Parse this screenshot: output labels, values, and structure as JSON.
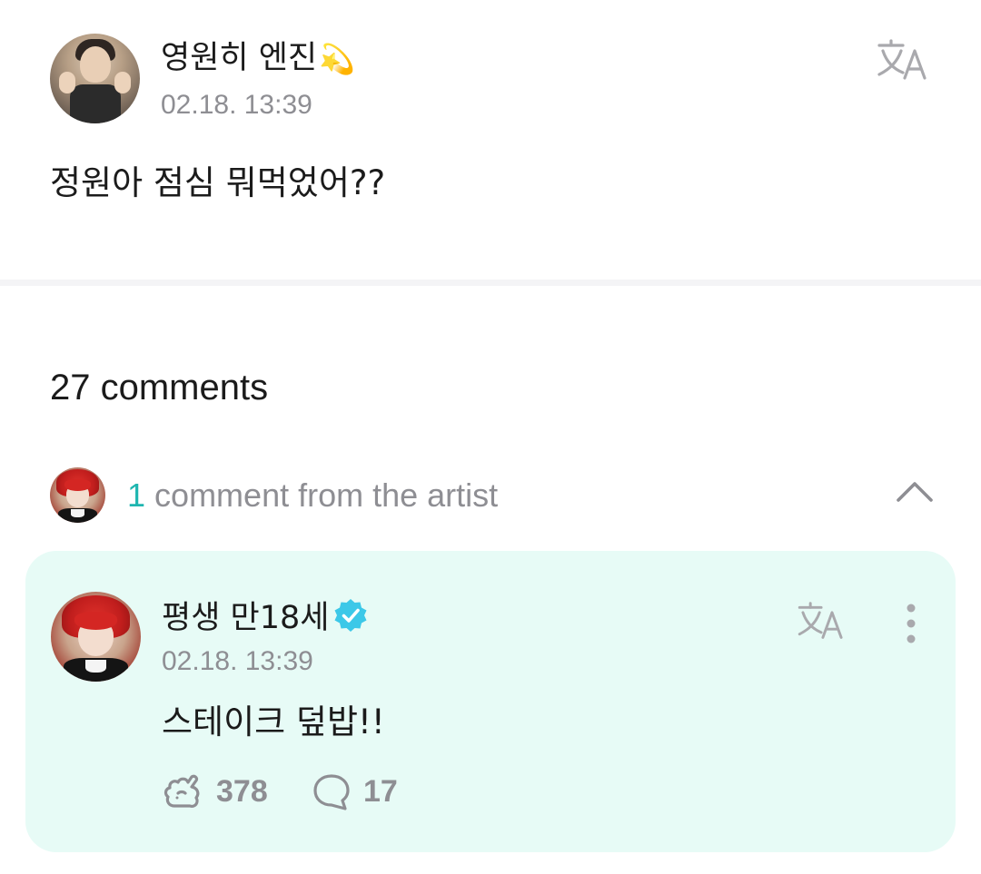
{
  "post": {
    "author": "영원히 엔진",
    "author_emoji": "💫",
    "timestamp": "02.18. 13:39",
    "text": "정원아 점심 뭐먹었어??",
    "icons": {
      "avatar": "user-avatar",
      "translate": "translate-icon"
    }
  },
  "comments": {
    "count_label": "27 comments",
    "artist_summary": {
      "count": "1",
      "label": "comment from the artist",
      "icons": {
        "collapse": "chevron-up-icon"
      }
    }
  },
  "artist_comment": {
    "author": "평생 만18세",
    "timestamp": "02.18. 13:39",
    "text": "스테이크 덮밥!!",
    "likes": "378",
    "replies": "17",
    "icons": {
      "verified": "verified-badge-icon",
      "translate": "translate-icon",
      "more": "more-vertical-icon",
      "like": "like-icon",
      "reply": "reply-bubble-icon"
    }
  },
  "colors": {
    "accent": "#1fb6b0",
    "card_background": "#e7fbf6",
    "verified": "#3cc8e8",
    "muted_text": "#8e8e93"
  }
}
